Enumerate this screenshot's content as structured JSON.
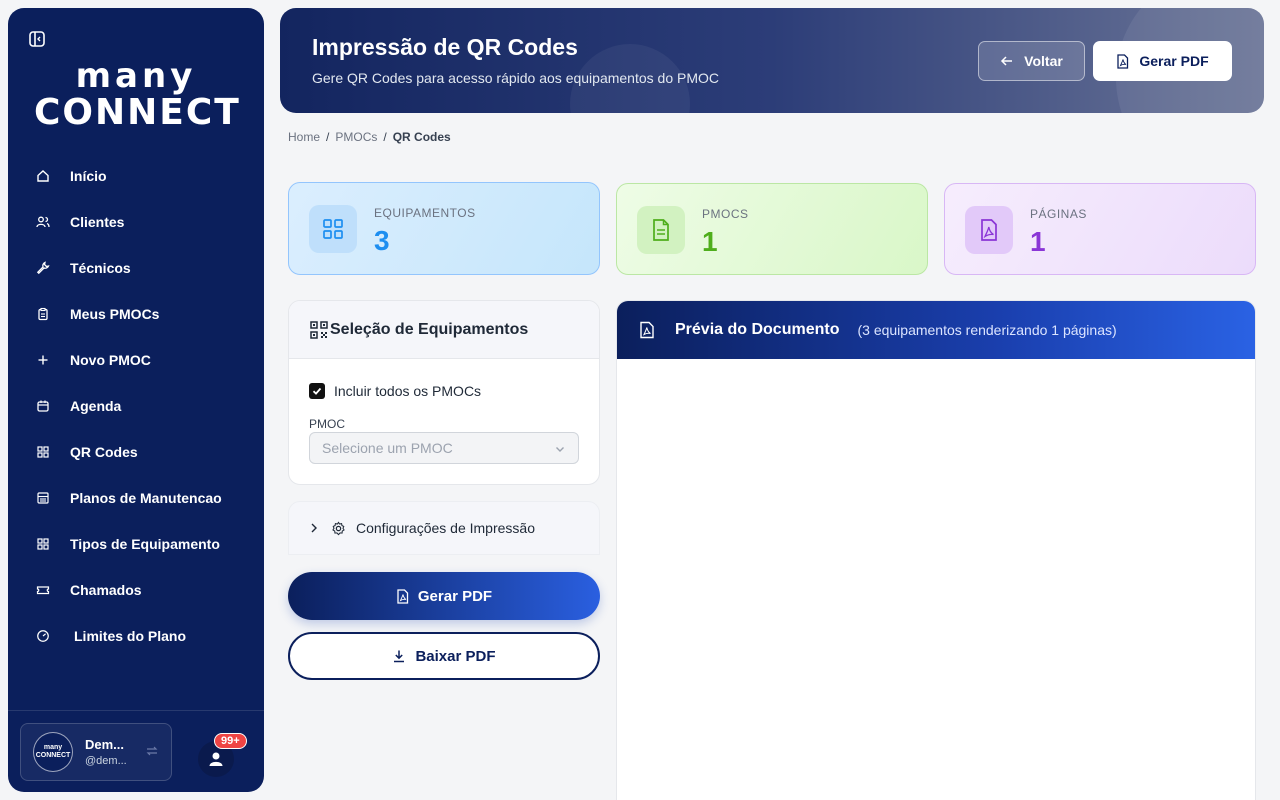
{
  "app": {
    "logo_line1": "many",
    "logo_line2": "CONNECT"
  },
  "sidebar": {
    "items": [
      {
        "label": "Início",
        "icon": "home-icon"
      },
      {
        "label": "Clientes",
        "icon": "users-icon"
      },
      {
        "label": "Técnicos",
        "icon": "wrench-icon"
      },
      {
        "label": "Meus PMOCs",
        "icon": "clipboard-icon"
      },
      {
        "label": "Novo PMOC",
        "icon": "plus-icon"
      },
      {
        "label": "Agenda",
        "icon": "calendar-icon"
      },
      {
        "label": "QR Codes",
        "icon": "qr-grid-icon"
      },
      {
        "label": "Planos de Manutencao",
        "icon": "list-icon"
      },
      {
        "label": "Tipos de Equipamento",
        "icon": "grid-icon"
      },
      {
        "label": "Chamados",
        "icon": "ticket-icon"
      },
      {
        "label": "Limites do Plano",
        "icon": "gauge-icon"
      }
    ]
  },
  "user": {
    "avatar_line1": "many",
    "avatar_line2": "CONNECT",
    "name": "Dem...",
    "handle": "@dem...",
    "notifications": "99+"
  },
  "header": {
    "title": "Impressão de QR Codes",
    "subtitle": "Gere QR Codes para acesso rápido aos equipamentos do PMOC",
    "back_label": "Voltar",
    "pdf_label": "Gerar PDF"
  },
  "breadcrumb": [
    "Home",
    "PMOCs",
    "QR Codes"
  ],
  "stats": {
    "equipamentos": {
      "label": "EQUIPAMENTOS",
      "value": "3"
    },
    "pmocs": {
      "label": "PMOCS",
      "value": "1"
    },
    "paginas": {
      "label": "PÁGINAS",
      "value": "1"
    }
  },
  "selection": {
    "title": "Seleção de Equipamentos",
    "include_all_label": "Incluir todos os PMOCs",
    "include_all_checked": true,
    "pmoc_label": "PMOC",
    "pmoc_placeholder": "Selecione um PMOC"
  },
  "config": {
    "label": "Configurações de Impressão"
  },
  "actions": {
    "generate_label": "Gerar PDF",
    "download_label": "Baixar PDF"
  },
  "preview": {
    "title": "Prévia do Documento",
    "subtitle": "(3 equipamentos renderizando 1 páginas)"
  },
  "colors": {
    "primary": "#0b1f5c",
    "accent_blue": "#2a62e4",
    "stat_blue": "#1d8ef0",
    "stat_green": "#4fae1c",
    "stat_purple": "#8a35d6",
    "badge_red": "#ef4444"
  }
}
